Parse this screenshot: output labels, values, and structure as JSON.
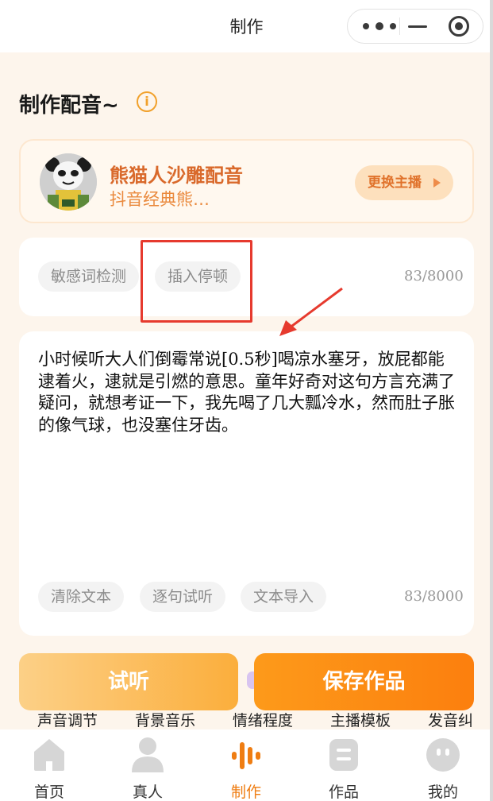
{
  "titlebar": {
    "title": "制作",
    "more_icon": "more-dots-icon",
    "minimize_icon": "minimize-icon",
    "close_icon": "target-close-icon"
  },
  "heading": {
    "text": "制作配音~",
    "info_icon": "info-icon",
    "info_glyph": "i"
  },
  "voice": {
    "name": "熊猫人沙雕配音",
    "description": "抖音经典熊…",
    "change_label": "更换主播",
    "avatar_icon": "panda-avatar-icon",
    "avatar_text": "熊猫人"
  },
  "tools": {
    "sensitive_check": "敏感词检测",
    "insert_pause": "插入停顿",
    "count": "83/8000"
  },
  "editor": {
    "text": "小时候听大人们倒霉常说[0.5秒]喝凉水塞牙，放屁都能逮着火，逮就是引燃的意思。童年好奇对这句方言充满了疑问，就想考证一下，我先喝了几大瓢冷水，然而肚子胀的像气球，也没塞住牙齿。",
    "clear_label": "清除文本",
    "preview_label": "逐句试听",
    "import_label": "文本导入",
    "count": "83/8000"
  },
  "actions": {
    "listen_label": "试听",
    "save_label": "保存作品"
  },
  "features": [
    "声音调节",
    "背景音乐",
    "情绪程度",
    "主播模板",
    "发音纠"
  ],
  "tabs": [
    {
      "label": "首页",
      "icon": "home-icon"
    },
    {
      "label": "真人",
      "icon": "person-icon"
    },
    {
      "label": "制作",
      "icon": "soundwave-icon"
    },
    {
      "label": "作品",
      "icon": "works-icon"
    },
    {
      "label": "我的",
      "icon": "profile-face-icon"
    }
  ],
  "colors": {
    "accent": "#ef7d12",
    "annotation_red": "#e63a2e",
    "voice_name": "#d9692b"
  }
}
